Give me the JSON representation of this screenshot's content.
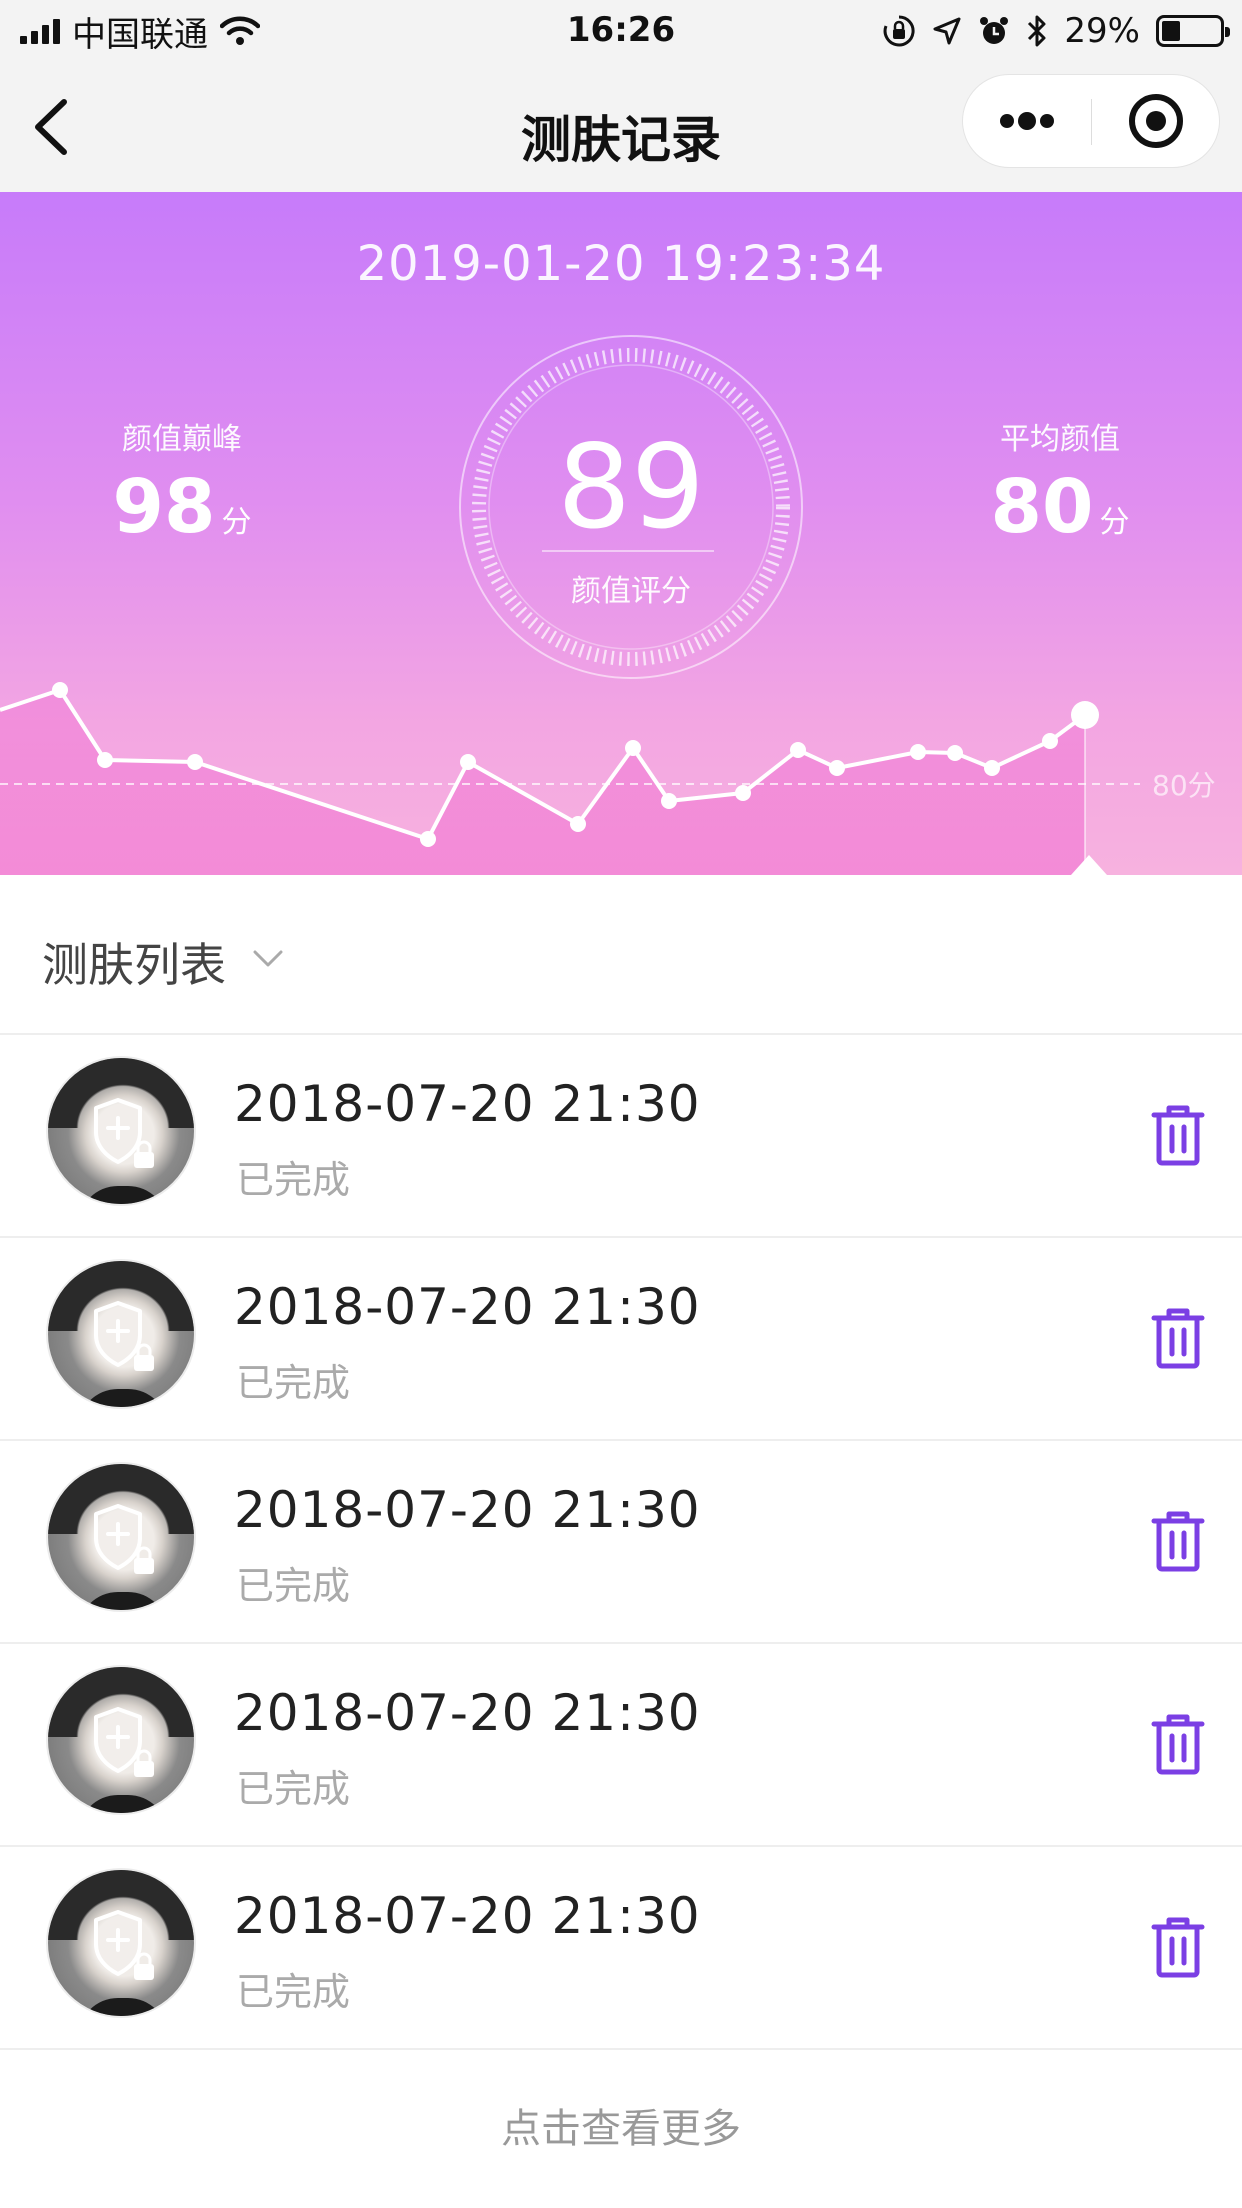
{
  "status_bar": {
    "carrier": "中国联通",
    "time": "16:26",
    "battery_percent": "29%"
  },
  "nav": {
    "title": "测肤记录"
  },
  "hero": {
    "datetime": "2019-01-20 19:23:34",
    "peak": {
      "label": "颜值巅峰",
      "value": "98",
      "unit": "分"
    },
    "average": {
      "label": "平均颜值",
      "value": "80",
      "unit": "分"
    },
    "score": {
      "value": "89",
      "label": "颜值评分"
    },
    "avg_line_label": "80分",
    "colors": {
      "gradient_top": "#c77bfa",
      "gradient_bottom": "#f7b2df"
    }
  },
  "list": {
    "title": "测肤列表",
    "items": [
      {
        "date": "2018-07-20 21:30",
        "status": "已完成"
      },
      {
        "date": "2018-07-20 21:30",
        "status": "已完成"
      },
      {
        "date": "2018-07-20 21:30",
        "status": "已完成"
      },
      {
        "date": "2018-07-20 21:30",
        "status": "已完成"
      },
      {
        "date": "2018-07-20 21:30",
        "status": "已完成"
      }
    ],
    "load_more": "点击查看更多"
  },
  "icons": {
    "back": "chevron-left-icon",
    "more": "more-dots-icon",
    "close": "target-circle-icon",
    "trash": "trash-icon",
    "avatar_overlay": "shield-lock-icon"
  },
  "accent_color": "#7b3fe4"
}
